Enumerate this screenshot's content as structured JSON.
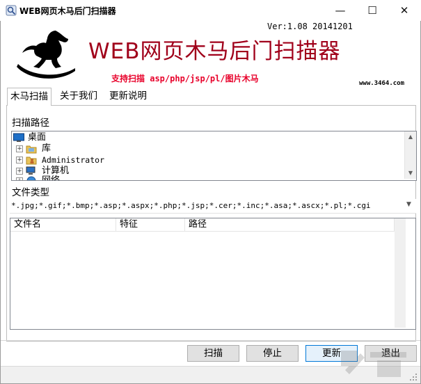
{
  "window": {
    "title": "WEB网页木马后门扫描器",
    "minimize_glyph": "—",
    "maximize_glyph": "☐",
    "close_glyph": "✕"
  },
  "banner": {
    "version": "Ver:1.08 20141201",
    "app_title": "WEB网页木马后门扫描器",
    "support_text": "支持扫描 asp/php/jsp/pl/图片木马",
    "site": "www.3464.com",
    "title_color": "#a0001a",
    "support_color": "#e8002a"
  },
  "tabs": [
    {
      "label": "木马扫描",
      "active": true
    },
    {
      "label": "关于我们",
      "active": false
    },
    {
      "label": "更新说明",
      "active": false
    }
  ],
  "scan_path": {
    "label": "扫描路径",
    "tree": [
      {
        "label": "桌面",
        "icon": "desktop-icon"
      },
      {
        "label": "库",
        "icon": "library-folder-icon"
      },
      {
        "label": "Administrator",
        "icon": "user-folder-icon"
      },
      {
        "label": "计算机",
        "icon": "computer-icon"
      },
      {
        "label": "网络",
        "icon": "network-icon"
      }
    ],
    "expander_glyph": "+",
    "scroll_up_glyph": "▲",
    "scroll_down_glyph": "▼"
  },
  "file_type": {
    "label": "文件类型",
    "value": "*.jpg;*.gif;*.bmp;*.asp;*.aspx;*.php;*.jsp;*.cer;*.inc;*.asa;*.ascx;*.pl;*.cgi",
    "dropdown_glyph": "▼"
  },
  "results": {
    "columns": [
      "文件名",
      "特征",
      "路径"
    ],
    "rows": []
  },
  "buttons": {
    "scan": "扫描",
    "stop": "停止",
    "update": "更新",
    "exit": "退出"
  },
  "colors": {
    "accent": "#0078d7",
    "button_face": "#e1e1e1",
    "border": "#828790"
  }
}
